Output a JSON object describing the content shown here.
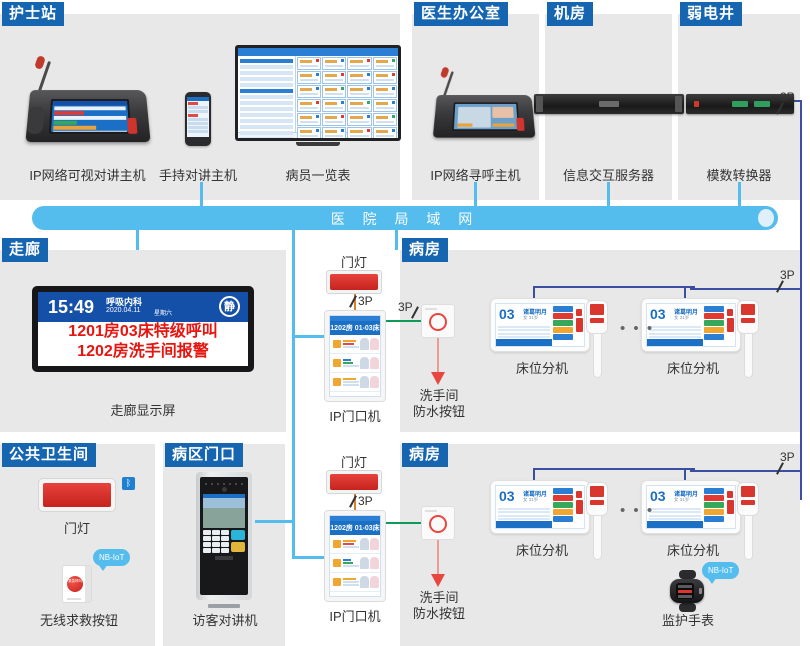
{
  "network": {
    "label": "医 院 局 域 网"
  },
  "sections": {
    "nurse_station": {
      "badge": "护士站",
      "devices": [
        {
          "name": "IP网络可视对讲主机"
        },
        {
          "name": "手持对讲主机"
        },
        {
          "name": "病员一览表"
        }
      ]
    },
    "doctor_office": {
      "badge": "医生办公室",
      "device": "IP网络寻呼主机"
    },
    "machine_room": {
      "badge": "机房",
      "device": "信息交互服务器"
    },
    "weak_current_well": {
      "badge": "弱电井",
      "device": "模数转换器",
      "port": "3P"
    },
    "corridor": {
      "badge": "走廊",
      "device": "走廊显示屏",
      "display": {
        "time": "15:49",
        "department": "呼吸内科",
        "date": "2020.04.11",
        "weekday": "星期六",
        "mute_icon": "静",
        "alert_line1": "1201房03床特级呼叫",
        "alert_line2": "1202房洗手间报警"
      }
    },
    "door_column_top": {
      "door_lamp_label": "门灯",
      "port": "3P",
      "ip_door_label": "IP门口机",
      "ip_door_header": "1202房 01-03床"
    },
    "door_column_bottom": {
      "door_lamp_label": "门灯",
      "port": "3P",
      "ip_door_label": "IP门口机",
      "ip_door_header": "1202房 01-03床"
    },
    "ward_top": {
      "badge": "病房",
      "port_left": "3P",
      "port_right": "3P",
      "restroom_button": "洗手间\n防水按钮",
      "restroom_button_l1": "洗手间",
      "restroom_button_l2": "防水按钮",
      "bed_units": [
        {
          "label": "床位分机",
          "bed_no": "03",
          "patient": "诸葛明月",
          "meta": "女 31岁"
        },
        {
          "label": "床位分机",
          "bed_no": "03",
          "patient": "诸葛明月",
          "meta": "女 31岁"
        }
      ],
      "ellipsis": "• • •"
    },
    "ward_bottom": {
      "badge": "病房",
      "port_right": "3P",
      "restroom_button_l1": "洗手间",
      "restroom_button_l2": "防水按钮",
      "bed_units": [
        {
          "label": "床位分机",
          "bed_no": "03",
          "patient": "诸葛明月",
          "meta": "女 31岁"
        },
        {
          "label": "床位分机",
          "bed_no": "03",
          "patient": "诸葛明月",
          "meta": "女 31岁"
        }
      ],
      "ellipsis": "• • •",
      "watch_label": "监护手表",
      "watch_tag": "NB-IoT"
    },
    "public_restroom": {
      "badge": "公共卫生间",
      "door_lamp_label": "门灯",
      "bluetooth_icon": "ᛒ",
      "sos_label": "无线求救按钮",
      "sos_tag": "NB-IoT",
      "sos_button_text": "紧急呼叫"
    },
    "ward_entrance": {
      "badge": "病区门口",
      "device": "访客对讲机"
    }
  },
  "colors": {
    "badge_blue": "#1565b0",
    "lan_blue": "#54bdee",
    "alert_red": "#e8140f",
    "link_3p": "#3b4fa0",
    "panel_grey": "#e8e8e8"
  }
}
